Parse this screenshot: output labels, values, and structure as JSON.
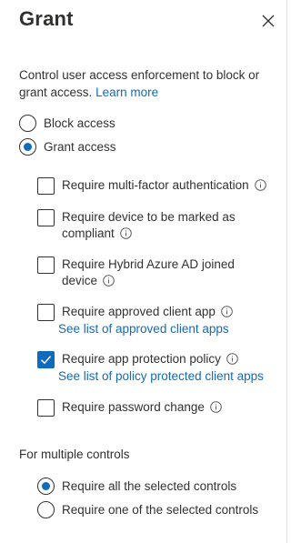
{
  "header": {
    "title": "Grant"
  },
  "description": {
    "text": "Control user access enforcement to block or grant access.",
    "learn_more": "Learn more"
  },
  "access_options": [
    {
      "label": "Block access",
      "checked": false
    },
    {
      "label": "Grant access",
      "checked": true
    }
  ],
  "controls": [
    {
      "label": "Require multi-factor authentication",
      "checked": false
    },
    {
      "label": "Require device to be marked as compliant",
      "checked": false
    },
    {
      "label": "Require Hybrid Azure AD joined device",
      "checked": false
    },
    {
      "label": "Require approved client app",
      "checked": false,
      "link": "See list of approved client apps"
    },
    {
      "label": "Require app protection policy",
      "checked": true,
      "link": "See list of policy protected client apps"
    },
    {
      "label": "Require password change",
      "checked": false
    }
  ],
  "multiple_controls": {
    "label": "For multiple controls",
    "options": [
      {
        "label": "Require all the selected controls",
        "checked": true
      },
      {
        "label": "Require one of the selected controls",
        "checked": false
      }
    ]
  },
  "colors": {
    "accent": "#0f6cbd",
    "text": "#323130"
  },
  "icons": {
    "close": "close-icon",
    "info": "info-icon",
    "check": "checkmark-icon"
  }
}
